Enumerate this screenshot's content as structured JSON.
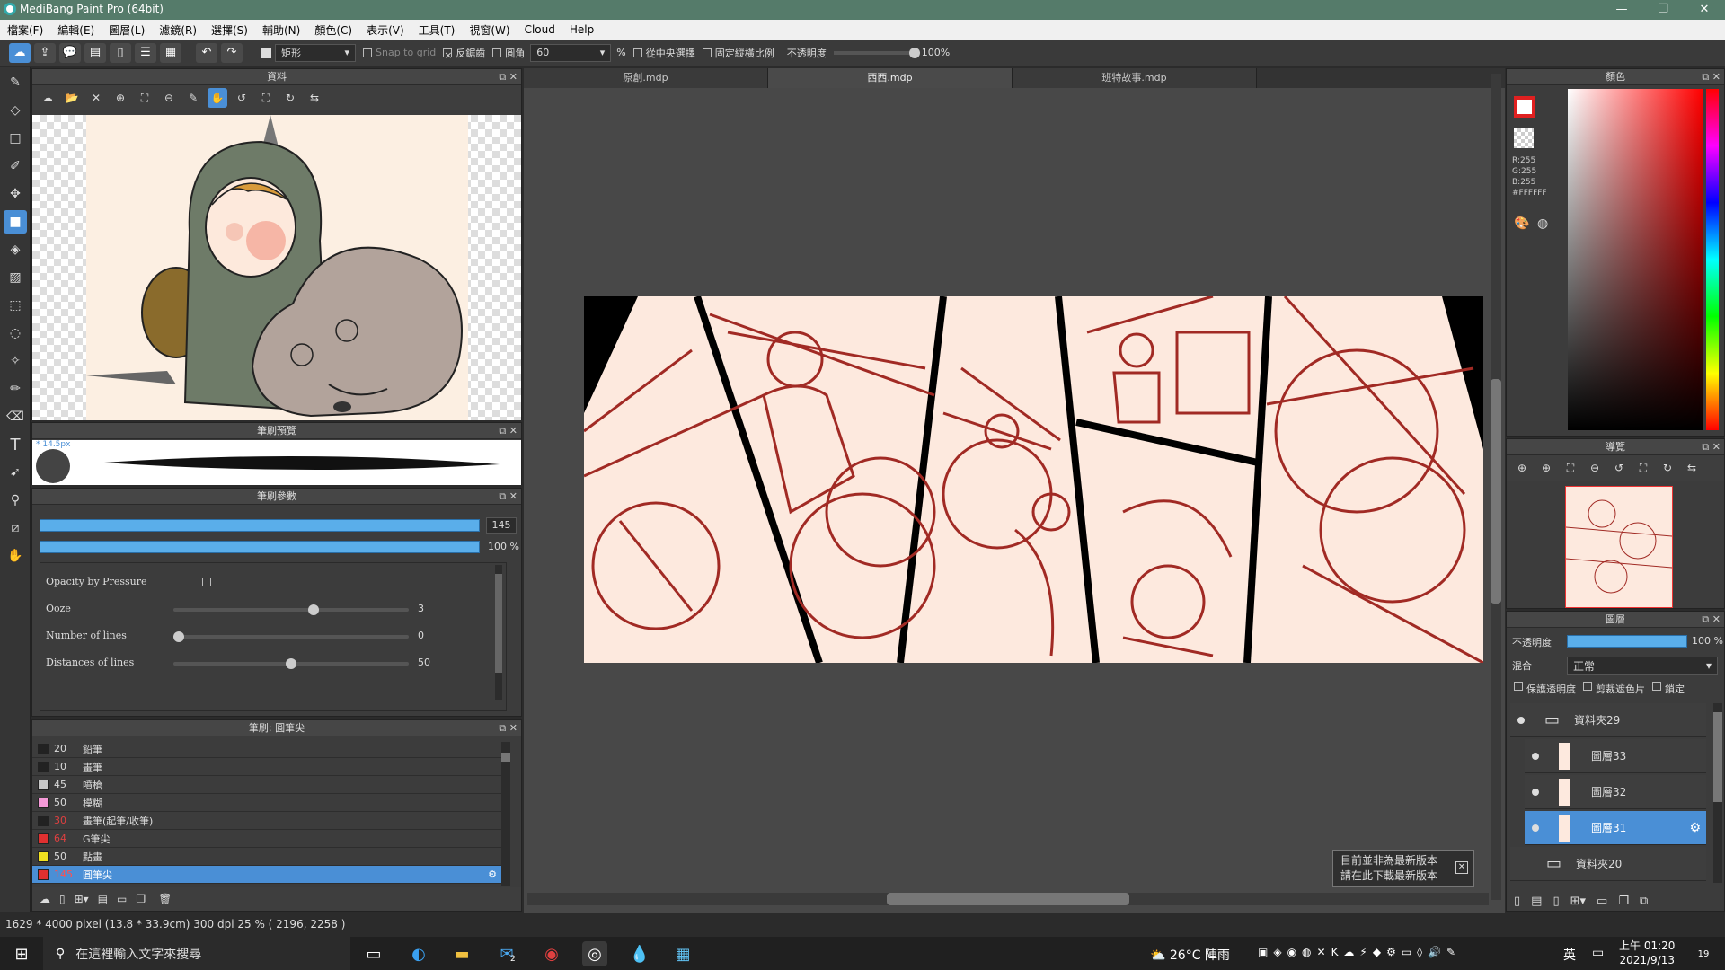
{
  "window": {
    "title": "MediBang Paint Pro (64bit)",
    "min": "—",
    "max": "❐",
    "close": "✕"
  },
  "menu": [
    "檔案(F)",
    "編輯(E)",
    "圖層(L)",
    "濾鏡(R)",
    "選擇(S)",
    "輔助(N)",
    "顏色(C)",
    "表示(V)",
    "工具(T)",
    "視窗(W)",
    "Cloud",
    "Help"
  ],
  "toolbar": {
    "shape": "矩形",
    "snap": "Snap to grid",
    "antialias": "反鋸齒",
    "round": "圓角",
    "round_value": "60",
    "percent": "%",
    "center": "從中央選擇",
    "fixed": "固定縱橫比例",
    "opacity_label": "不透明度",
    "opacity_value": "100%"
  },
  "material_panel": {
    "title": "資料"
  },
  "brush_preview": {
    "title": "筆刷預覽",
    "size_label": "* 14.5px"
  },
  "brush_params": {
    "title": "筆刷參數",
    "size": "145",
    "opacity": "100 %",
    "opacity_by_pressure": "Opacity by Pressure",
    "ooze_label": "Ooze",
    "ooze_value": "3",
    "lines_label": "Number of lines",
    "lines_value": "0",
    "dist_label": "Distances of lines",
    "dist_value": "50"
  },
  "brush_list": {
    "title": "筆刷: 圓筆尖",
    "items": [
      {
        "num": "20",
        "name": "鉛筆",
        "color": "#222222"
      },
      {
        "num": "10",
        "name": "畫筆",
        "color": "#222222"
      },
      {
        "num": "45",
        "name": "噴槍",
        "color": "#c8c8c8"
      },
      {
        "num": "50",
        "name": "模糊",
        "color": "#f59ad8"
      },
      {
        "num": "30",
        "name": "畫筆(起筆/收筆)",
        "color": "#222222",
        "numcolor": "#e04040"
      },
      {
        "num": "64",
        "name": "G筆尖",
        "color": "#e03030",
        "numcolor": "#e04040"
      },
      {
        "num": "50",
        "name": "點畫",
        "color": "#f0e020"
      },
      {
        "num": "145",
        "name": "圓筆尖",
        "color": "#e03030",
        "numcolor": "#ff5050",
        "selected": true
      }
    ]
  },
  "status": {
    "text": "1629 * 4000 pixel   (13.8 * 33.9cm)   300 dpi   25 %   ( 2196, 2258 )"
  },
  "tabs": [
    "原創.mdp",
    "西西.mdp",
    "班特故事.mdp"
  ],
  "color_panel": {
    "title": "顏色",
    "r": "R:255",
    "g": "G:255",
    "b": "B:255",
    "hex": "#FFFFFF"
  },
  "navigator": {
    "title": "導覽"
  },
  "layers": {
    "title": "圖層",
    "opacity_label": "不透明度",
    "opacity_value": "100 %",
    "blend_label": "混合",
    "blend_value": "正常",
    "protect": "保護透明度",
    "clip": "剪裁遮色片",
    "lock": "鎖定",
    "items": [
      {
        "name": "資料夾29",
        "type": "folder"
      },
      {
        "name": "圖層33"
      },
      {
        "name": "圖層32"
      },
      {
        "name": "圖層31",
        "selected": true
      },
      {
        "name": "資料夾20",
        "type": "folder"
      }
    ]
  },
  "notice": {
    "line1": "目前並非為最新版本",
    "line2": "請在此下載最新版本"
  },
  "taskbar": {
    "search": "在這裡輸入文字來搜尋",
    "weather": "26°C  陣雨",
    "ime": "英",
    "time": "上午 01:20",
    "date": "2021/9/13",
    "badge": "19",
    "mail_badge": "2"
  }
}
